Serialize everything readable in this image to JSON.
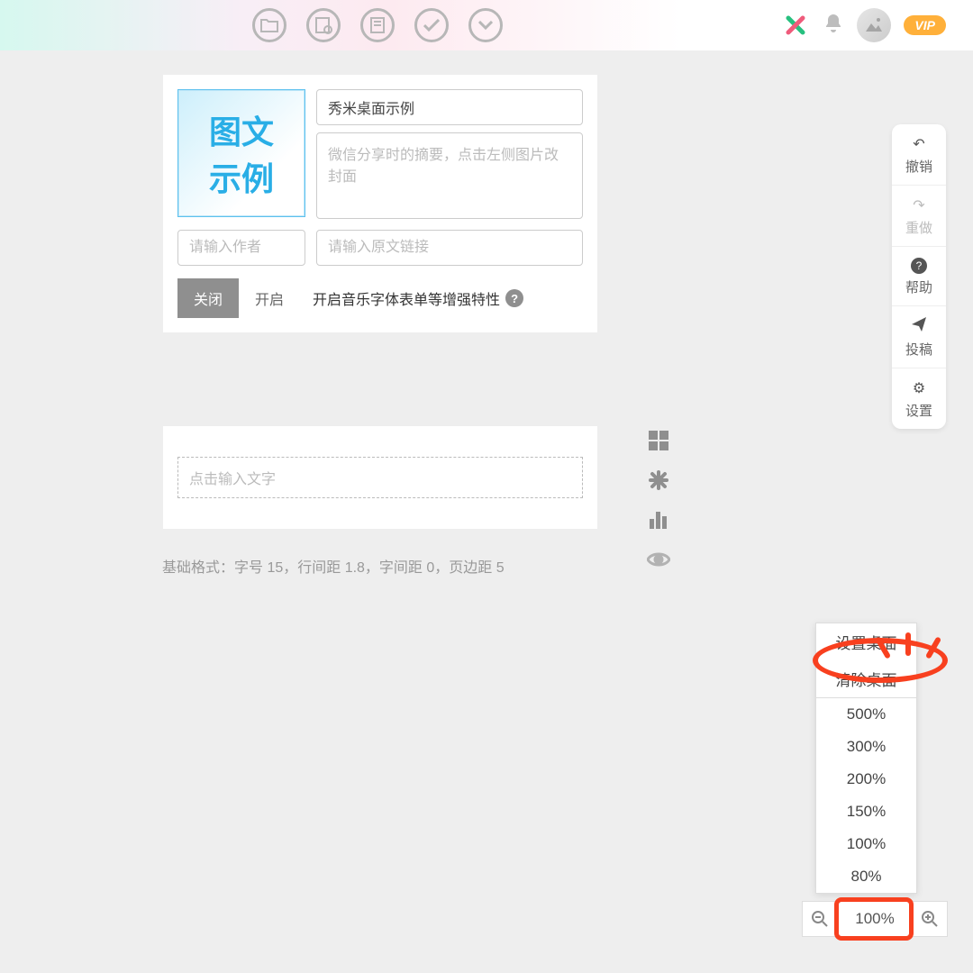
{
  "thumb": {
    "line1": "图文",
    "line2": "示例"
  },
  "fields": {
    "title_value": "秀米桌面示例",
    "summary_placeholder": "微信分享时的摘要，点击左侧图片改封面",
    "author_placeholder": "请输入作者",
    "source_placeholder": "请输入原文链接"
  },
  "toggle": {
    "off": "关闭",
    "on": "开启"
  },
  "enhance_label": "开启音乐字体表单等增强特性",
  "editor_placeholder": "点击输入文字",
  "format_line": "基础格式：字号 15，行间距 1.8，字间距 0，页边距 5",
  "rightrail": {
    "undo": "撤销",
    "redo": "重做",
    "help": "帮助",
    "submit": "投稿",
    "settings": "设置"
  },
  "zoom_menu": {
    "set_desktop": "设置桌面",
    "clear_desktop": "清除桌面",
    "levels": [
      "500%",
      "300%",
      "200%",
      "150%",
      "100%",
      "80%"
    ]
  },
  "zoom_current": "100%",
  "vip": "VIP"
}
